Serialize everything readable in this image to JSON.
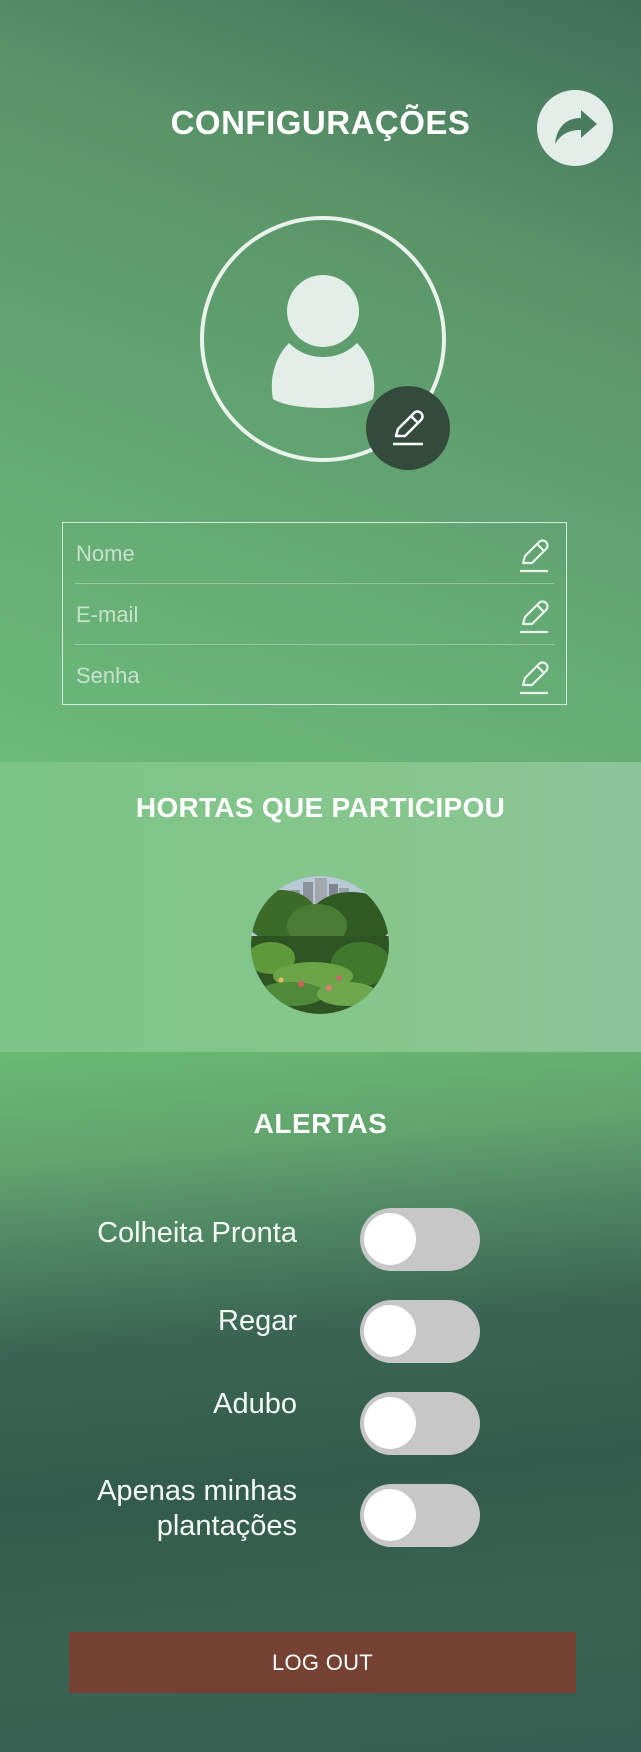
{
  "header": {
    "title": "CONFIGURAÇÕES",
    "share_icon": "share-arrow-icon"
  },
  "profile": {
    "avatar_icon": "user-silhouette-icon",
    "edit_photo_icon": "pencil-icon"
  },
  "fields": [
    {
      "placeholder": "Nome",
      "edit_icon": "pencil-icon"
    },
    {
      "placeholder": "E-mail",
      "edit_icon": "pencil-icon"
    },
    {
      "placeholder": "Senha",
      "edit_icon": "pencil-icon"
    }
  ],
  "hortas": {
    "title": "HORTAS QUE PARTICIPOU"
  },
  "alerts": {
    "title": "ALERTAS",
    "items": [
      {
        "label_lines": [
          "Colheita Pronta"
        ],
        "enabled": false
      },
      {
        "label_lines": [
          "Regar"
        ],
        "enabled": false
      },
      {
        "label_lines": [
          "Adubo"
        ],
        "enabled": false
      },
      {
        "label_lines": [
          "Apenas minhas",
          "plantações"
        ],
        "enabled": false
      }
    ]
  },
  "logout": {
    "label": "LOG OUT"
  },
  "colors": {
    "logout_bg": "#744133",
    "toggle_off": "#c7c7c7",
    "edit_photo_bg": "#344a3c"
  }
}
